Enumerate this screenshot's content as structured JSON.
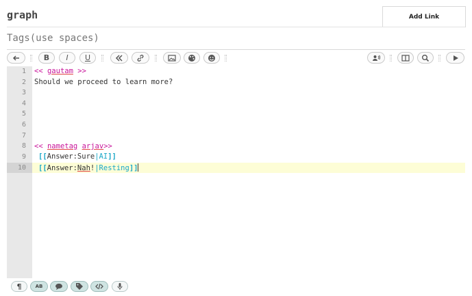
{
  "header": {
    "title": "graph",
    "add_link_label": "Add Link"
  },
  "tags": {
    "placeholder": "Tags(use spaces)"
  },
  "toolbar": {
    "buttons": [
      "undo-icon",
      "bold-icon",
      "italic-icon",
      "underline-icon",
      "macro-icon",
      "link-icon",
      "image-icon",
      "palette-icon",
      "emoji-icon",
      "speaker-icon",
      "split-view-icon",
      "search-icon",
      "play-icon"
    ],
    "bold_glyph": "B",
    "italic_glyph": "I",
    "underline_glyph": "U"
  },
  "editor": {
    "line_numbers": [
      "1",
      "2",
      "3",
      "4",
      "5",
      "6",
      "7",
      "8",
      "9",
      "10"
    ],
    "lines": [
      {
        "open": "<<",
        "name": "gautam",
        "close": ">>"
      },
      {
        "text": "Should we proceed to learn more?"
      },
      {},
      {},
      {},
      {},
      {},
      {
        "open": "<<",
        "macro": "nametag",
        "name": "arjav",
        "close": ">>"
      },
      {
        "lb": "[[",
        "label": "Answer",
        "colon": ":",
        "text": "Sure",
        "pipe": "|",
        "target": "AI",
        "rb": "]]"
      },
      {
        "lb": "[[",
        "label": "Answer",
        "colon": ":",
        "text": "Nah",
        "bang": "!",
        "pipe": "|",
        "target": "Resting",
        "rb": "]]"
      }
    ],
    "active_line": "10"
  },
  "footer": {
    "pilcrow_glyph": "¶",
    "spellcheck_glyph": "AB"
  },
  "colors": {
    "macro": "#c8149a",
    "link": "#1aa7c7",
    "highlight": "#fdfdd6"
  }
}
